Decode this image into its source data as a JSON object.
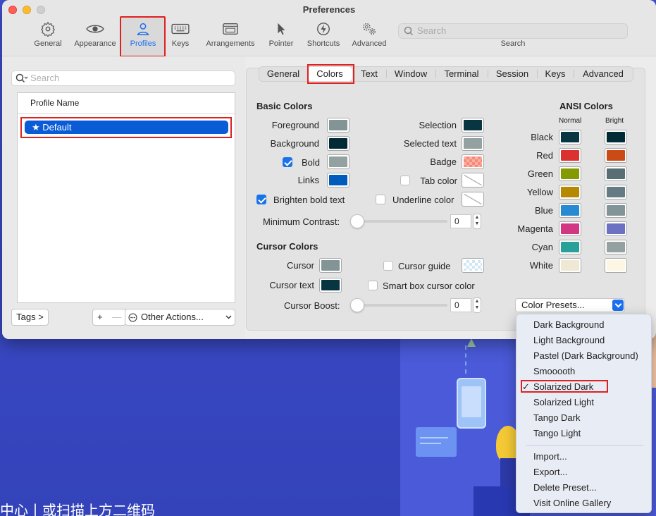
{
  "window": {
    "title": "Preferences"
  },
  "toolbar": {
    "items": [
      {
        "label": "General",
        "icon": "gear-icon"
      },
      {
        "label": "Appearance",
        "icon": "eye-icon"
      },
      {
        "label": "Profiles",
        "icon": "person-icon"
      },
      {
        "label": "Keys",
        "icon": "keyboard-icon"
      },
      {
        "label": "Arrangements",
        "icon": "windows-icon"
      },
      {
        "label": "Pointer",
        "icon": "pointer-icon"
      },
      {
        "label": "Shortcuts",
        "icon": "lightning-icon"
      },
      {
        "label": "Advanced",
        "icon": "gears-icon"
      }
    ],
    "active": "Profiles",
    "search_placeholder": "Search",
    "search_label": "Search"
  },
  "profiles": {
    "search_placeholder": "Search",
    "column_header": "Profile Name",
    "rows": [
      {
        "label": "★ Default",
        "selected": true
      }
    ],
    "tags_button": "Tags >",
    "add_button": "+",
    "remove_button": "—",
    "other_actions": "Other Actions..."
  },
  "tabs": {
    "items": [
      "General",
      "Colors",
      "Text",
      "Window",
      "Terminal",
      "Session",
      "Keys",
      "Advanced"
    ],
    "active": "Colors"
  },
  "basic_colors": {
    "title": "Basic Colors",
    "foreground": {
      "label": "Foreground",
      "color": "#839496"
    },
    "background": {
      "label": "Background",
      "color": "#002b36"
    },
    "bold": {
      "label": "Bold",
      "checked": true,
      "color": "#93a1a1"
    },
    "links": {
      "label": "Links",
      "color": "#005bbb"
    },
    "brighten": {
      "label": "Brighten bold text",
      "checked": true
    },
    "selection": {
      "label": "Selection",
      "color": "#073642"
    },
    "selected_text": {
      "label": "Selected text",
      "color": "#93a1a1"
    },
    "badge": {
      "label": "Badge"
    },
    "tab_color": {
      "label": "Tab color",
      "checked": false
    },
    "underline_color": {
      "label": "Underline color",
      "checked": false
    },
    "min_contrast": {
      "label": "Minimum Contrast:",
      "value": "0"
    }
  },
  "cursor_colors": {
    "title": "Cursor Colors",
    "cursor": {
      "label": "Cursor",
      "color": "#839496"
    },
    "cursor_text": {
      "label": "Cursor text",
      "color": "#073642"
    },
    "cursor_guide": {
      "label": "Cursor guide",
      "checked": false
    },
    "smart_box": {
      "label": "Smart box cursor color",
      "checked": false
    },
    "boost": {
      "label": "Cursor Boost:",
      "value": "0"
    }
  },
  "ansi": {
    "title": "ANSI Colors",
    "normal_label": "Normal",
    "bright_label": "Bright",
    "rows": [
      {
        "name": "Black",
        "normal": "#073642",
        "bright": "#002b36"
      },
      {
        "name": "Red",
        "normal": "#dc322f",
        "bright": "#cb4b16"
      },
      {
        "name": "Green",
        "normal": "#859900",
        "bright": "#586e75"
      },
      {
        "name": "Yellow",
        "normal": "#b58900",
        "bright": "#657b83"
      },
      {
        "name": "Blue",
        "normal": "#268bd2",
        "bright": "#839496"
      },
      {
        "name": "Magenta",
        "normal": "#d33682",
        "bright": "#6c71c4"
      },
      {
        "name": "Cyan",
        "normal": "#2aa198",
        "bright": "#93a1a1"
      },
      {
        "name": "White",
        "normal": "#eee8d5",
        "bright": "#fdf6e3"
      }
    ]
  },
  "color_presets": {
    "label": "Color Presets...",
    "options": [
      "Dark Background",
      "Light Background",
      "Pastel (Dark Background)",
      "Smooooth",
      "Solarized Dark",
      "Solarized Light",
      "Tango Dark",
      "Tango Light"
    ],
    "checked": "Solarized Dark",
    "check_mark": "✓",
    "actions": [
      "Import...",
      "Export...",
      "Delete Preset...",
      "Visit Online Gallery"
    ]
  },
  "background": {
    "text": "中心丨或扫描上方二维码"
  }
}
